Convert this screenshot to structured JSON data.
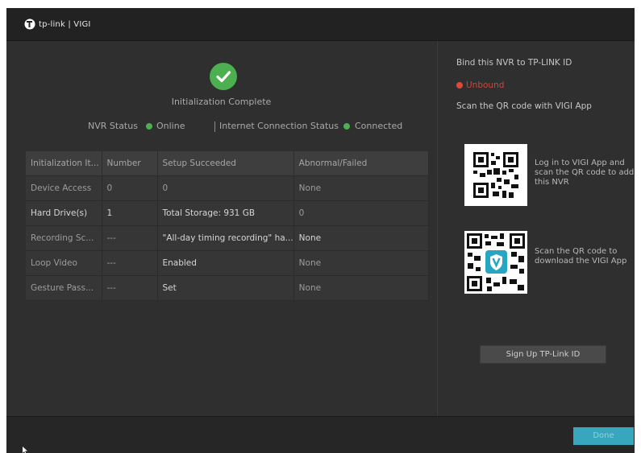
{
  "header": {
    "brand": "tp-link | VIGI"
  },
  "main": {
    "title": "Initialization Complete",
    "nvr_status_label": "NVR Status",
    "nvr_status_value": "Online",
    "internet_status_label": "Internet Connection Status",
    "internet_status_value": "Connected",
    "table": {
      "headers": [
        "Initialization It...",
        "Number",
        "Setup Succeeded",
        "Abnormal/Failed"
      ],
      "rows": [
        [
          "Device Access",
          "0",
          "0",
          "None"
        ],
        [
          "Hard Drive(s)",
          "1",
          "Total Storage: 931 GB",
          "0"
        ],
        [
          "Recording Sc...",
          "---",
          "\"All-day timing recording\" ha...",
          "None"
        ],
        [
          "Loop Video",
          "---",
          "Enabled",
          "None"
        ],
        [
          "Gesture Pass...",
          "---",
          "Set",
          "None"
        ]
      ]
    }
  },
  "side": {
    "bind_title": "Bind this NVR to TP-LINK ID",
    "bind_status": "Unbound",
    "scan_title": "Scan the QR code with VIGI App",
    "qr1_text": "Log in to VIGI App and scan the QR code to add this NVR",
    "qr2_text": "Scan the QR code to download the VIGI App",
    "signup_label": "Sign Up TP-Link ID"
  },
  "footer": {
    "done_label": "Done"
  },
  "colors": {
    "online": "#4caf50",
    "unbound": "#e0483a",
    "accent": "#38a7bd"
  }
}
